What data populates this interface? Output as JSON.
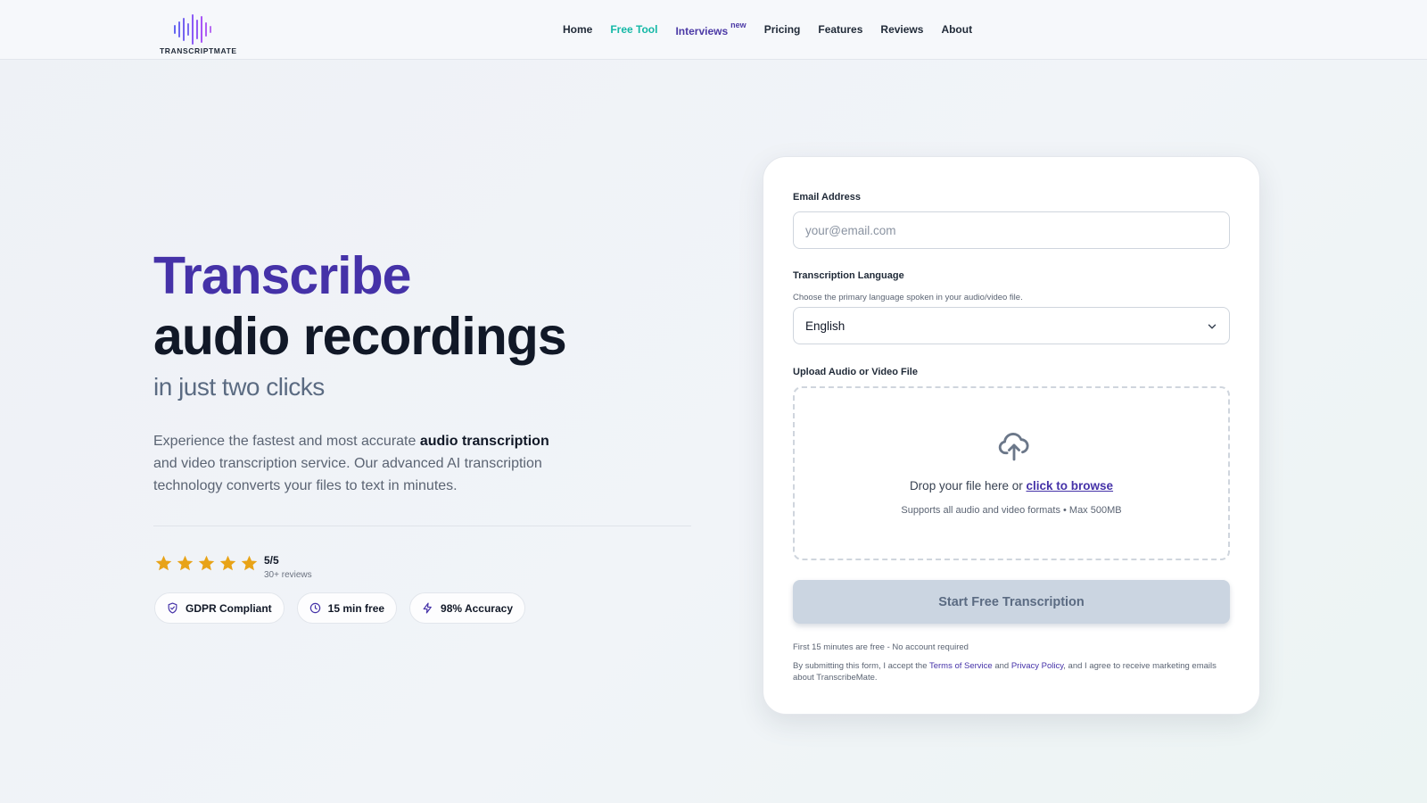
{
  "brand": {
    "name": "TRANSCRIPTMATE",
    "logo_colors": [
      "#6366f1",
      "#7c6df0",
      "#8b5cf6",
      "#a855f7",
      "#b86cf2"
    ]
  },
  "nav": {
    "home": "Home",
    "free_tool": "Free Tool",
    "interviews": "Interviews",
    "interviews_badge": "new",
    "pricing": "Pricing",
    "features": "Features",
    "reviews": "Reviews",
    "about": "About"
  },
  "hero": {
    "title_line1": "Transcribe",
    "title_line2": "audio recordings",
    "subtitle": "in just two clicks",
    "desc_part1": "Experience the fastest and most accurate ",
    "desc_bold": "audio transcription",
    "desc_part2": " and video transcription service. Our advanced AI transcription technology converts your files to text in minutes."
  },
  "rating": {
    "stars": 5,
    "score": "5/5",
    "count": "30+ reviews",
    "star_color": "#e8a317"
  },
  "badges": {
    "gdpr": "GDPR Compliant",
    "free_minutes": "15 min free",
    "accuracy": "98% Accuracy"
  },
  "form": {
    "email_label": "Email Address",
    "email_placeholder": "your@email.com",
    "email_value": "",
    "language_label": "Transcription Language",
    "language_helper": "Choose the primary language spoken in your audio/video file.",
    "language_selected": "English",
    "upload_label": "Upload Audio or Video File",
    "drop_text": "Drop your file here or ",
    "browse_link": "click to browse",
    "drop_hint": "Supports all audio and video formats • Max 500MB",
    "submit_label": "Start Free Transcription",
    "free_note": "First 15 minutes are free - No account required",
    "consent_part1": "By submitting this form, I accept the ",
    "terms_link": "Terms of Service",
    "consent_and": " and ",
    "privacy_link": "Privacy Policy",
    "consent_part2": ", and I agree to receive marketing emails about TranscribeMate."
  },
  "colors": {
    "accent_purple": "#4532a8",
    "accent_teal": "#14b8a6",
    "button_disabled": "#cbd5e1"
  }
}
